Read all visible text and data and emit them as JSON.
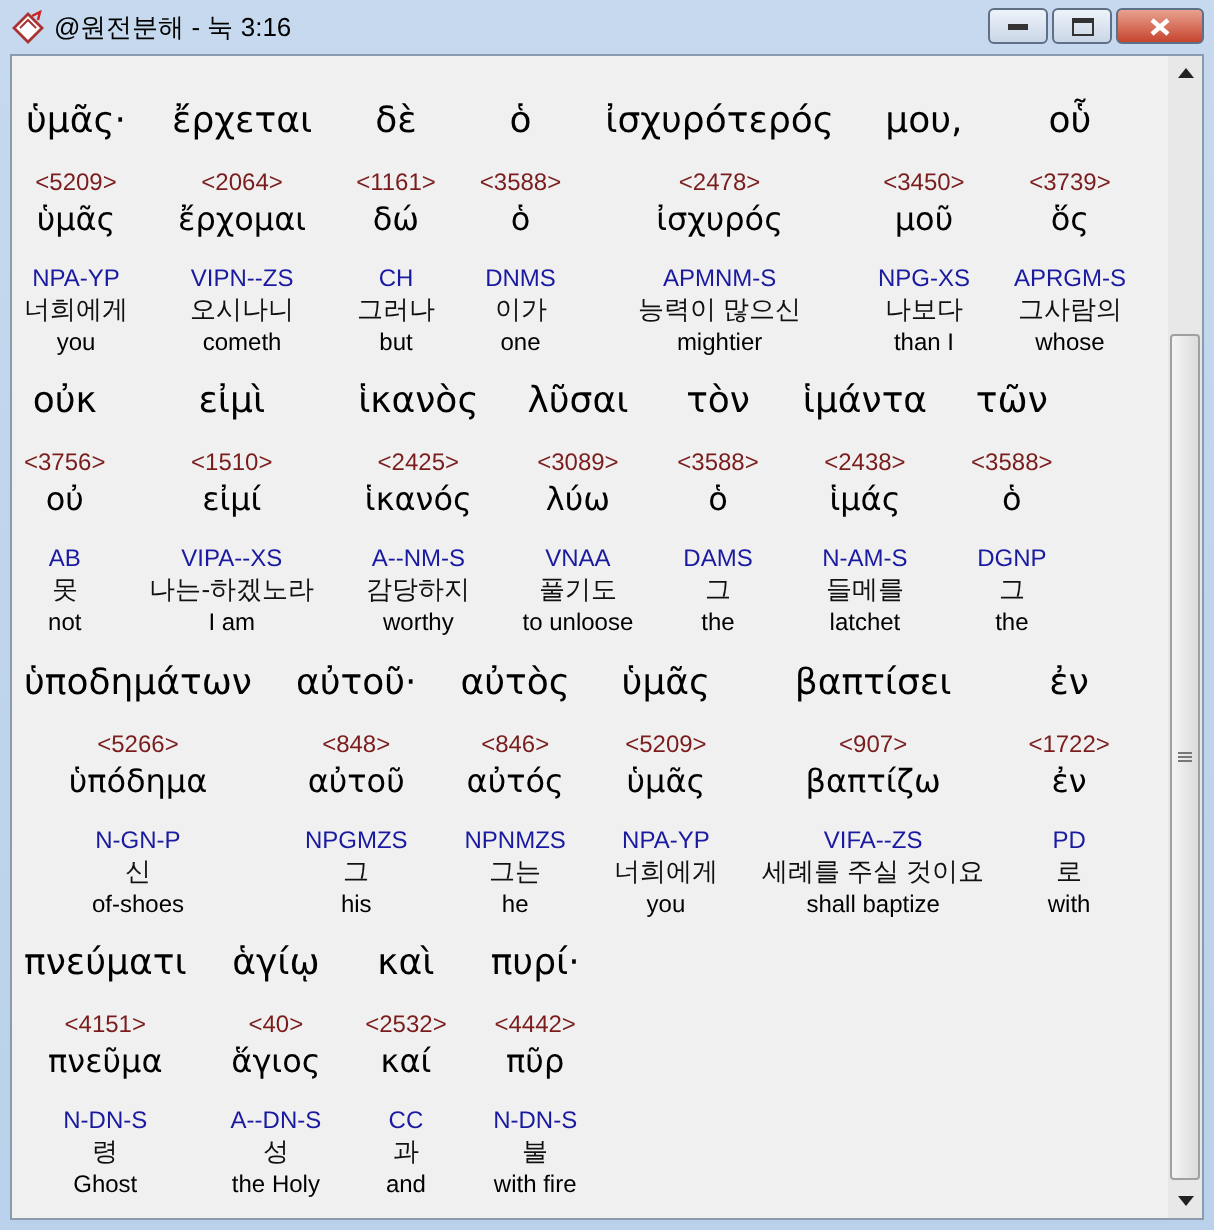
{
  "window": {
    "title": "@원전분해 - 눅 3:16"
  },
  "lines": [
    [
      {
        "greek": "ὑμᾶς·",
        "strong": "<5209>",
        "lemma": "ὑμᾶς",
        "morph": "NPA-YP",
        "korean": "너희에게",
        "english": "you"
      },
      {
        "greek": "ἔρχεται",
        "strong": "<2064>",
        "lemma": "ἔρχομαι",
        "morph": "VIPN--ZS",
        "korean": "오시나니",
        "english": "cometh"
      },
      {
        "greek": "δὲ",
        "strong": "<1161>",
        "lemma": "δώ",
        "morph": "CH",
        "korean": "그러나",
        "english": "but"
      },
      {
        "greek": "ὁ",
        "strong": "<3588>",
        "lemma": "ὁ",
        "morph": "DNMS",
        "korean": "이가",
        "english": "one"
      },
      {
        "greek": "ἰσχυρότερός",
        "strong": "<2478>",
        "lemma": "ἰσχυρός",
        "morph": "APMNM-S",
        "korean": "능력이 많으신",
        "english": "mightier"
      },
      {
        "greek": "μου,",
        "strong": "<3450>",
        "lemma": "μοῦ",
        "morph": "NPG-XS",
        "korean": "나보다",
        "english": "than I"
      },
      {
        "greek": "οὗ",
        "strong": "<3739>",
        "lemma": "ὅς",
        "morph": "APRGM-S",
        "korean": "그사람의",
        "english": "whose"
      }
    ],
    [
      {
        "greek": "οὐκ",
        "strong": "<3756>",
        "lemma": "οὐ",
        "morph": "AB",
        "korean": "못",
        "english": "not"
      },
      {
        "greek": "εἰμὶ",
        "strong": "<1510>",
        "lemma": "εἰμί",
        "morph": "VIPA--XS",
        "korean": "나는-하겠노라",
        "english": "I am"
      },
      {
        "greek": "ἱκανὸς",
        "strong": "<2425>",
        "lemma": "ἱκανός",
        "morph": "A--NM-S",
        "korean": "감당하지",
        "english": "worthy"
      },
      {
        "greek": "λῦσαι",
        "strong": "<3089>",
        "lemma": "λύω",
        "morph": "VNAA",
        "korean": "풀기도",
        "english": "to unloose"
      },
      {
        "greek": "τὸν",
        "strong": "<3588>",
        "lemma": "ὁ",
        "morph": "DAMS",
        "korean": "그",
        "english": "the"
      },
      {
        "greek": "ἱμάντα",
        "strong": "<2438>",
        "lemma": "ἱμάς",
        "morph": "N-AM-S",
        "korean": "들메를",
        "english": "latchet"
      },
      {
        "greek": "τῶν",
        "strong": "<3588>",
        "lemma": "ὁ",
        "morph": "DGNP",
        "korean": "그",
        "english": "the"
      }
    ],
    [
      {
        "greek": "ὑποδημάτων",
        "strong": "<5266>",
        "lemma": "ὑπόδημα",
        "morph": "N-GN-P",
        "korean": "신",
        "english": "of-shoes"
      },
      {
        "greek": "αὐτοῦ·",
        "strong": "<848>",
        "lemma": "αὐτοῦ",
        "morph": "NPGMZS",
        "korean": "그",
        "english": "his"
      },
      {
        "greek": "αὐτὸς",
        "strong": "<846>",
        "lemma": "αὐτός",
        "morph": "NPNMZS",
        "korean": "그는",
        "english": "he"
      },
      {
        "greek": "ὑμᾶς",
        "strong": "<5209>",
        "lemma": "ὑμᾶς",
        "morph": "NPA-YP",
        "korean": "너희에게",
        "english": "you"
      },
      {
        "greek": "βαπτίσει",
        "strong": "<907>",
        "lemma": "βαπτίζω",
        "morph": "VIFA--ZS",
        "korean": "세례를 주실 것이요",
        "english": "shall baptize"
      },
      {
        "greek": "ἐν",
        "strong": "<1722>",
        "lemma": "ἐν",
        "morph": "PD",
        "korean": "로",
        "english": "with"
      }
    ],
    [
      {
        "greek": "πνεύματι",
        "strong": "<4151>",
        "lemma": "πνεῦμα",
        "morph": "N-DN-S",
        "korean": "령",
        "english": "Ghost"
      },
      {
        "greek": "ἁγίῳ",
        "strong": "<40>",
        "lemma": "ἅγιος",
        "morph": "A--DN-S",
        "korean": "성",
        "english": "the Holy"
      },
      {
        "greek": "καὶ",
        "strong": "<2532>",
        "lemma": "καί",
        "morph": "CC",
        "korean": "과",
        "english": "and"
      },
      {
        "greek": "πυρί·",
        "strong": "<4442>",
        "lemma": "πῦρ",
        "morph": "N-DN-S",
        "korean": "불",
        "english": "with fire"
      }
    ]
  ]
}
